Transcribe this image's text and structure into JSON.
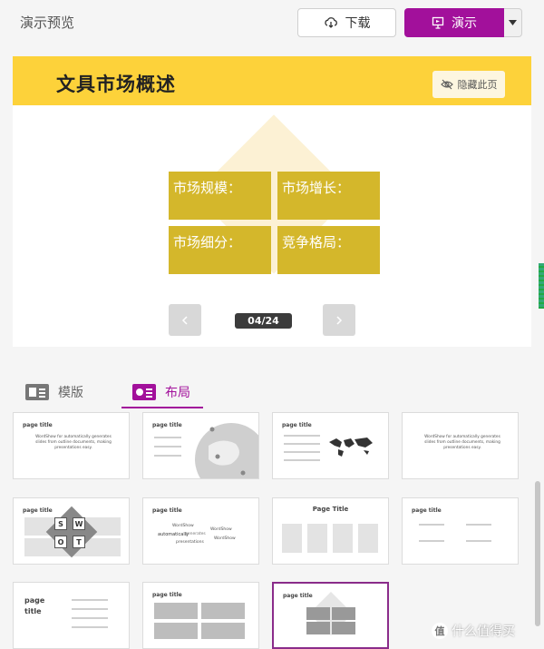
{
  "header": {
    "title": "演示预览",
    "download_label": "下载",
    "present_label": "演示"
  },
  "slide": {
    "title": "文具市场概述",
    "hide_page_label": "隐藏此页",
    "quadrants": [
      "市场规模：",
      "市场增长：",
      "市场细分：",
      "竞争格局："
    ],
    "page_indicator": "04/24"
  },
  "tabs": [
    {
      "label": "模版",
      "active": false
    },
    {
      "label": "布局",
      "active": true
    }
  ],
  "thumbnails": [
    {
      "title": "page title",
      "body": "WordShow for automatically generates slides from outline documents, making presentations easy."
    },
    {
      "title": "page title"
    },
    {
      "title": "page title"
    },
    {
      "title": "",
      "body": "WordShow for automatically generates slides from outline documents, making presentations easy."
    },
    {
      "title": "page title",
      "letters": [
        "S",
        "W",
        "O",
        "T"
      ]
    },
    {
      "title": "page title",
      "words": [
        "WordShow",
        "automatically",
        "generates",
        "WordShow",
        "presentations",
        "WordShow"
      ]
    },
    {
      "title": "Page Title"
    },
    {
      "title": "page title"
    },
    {
      "title": "page title"
    },
    {
      "title": "page title"
    },
    {
      "title": "page title",
      "selected": true
    }
  ],
  "watermark": {
    "text": "什么值得买",
    "icon_char": "值"
  },
  "colors": {
    "accent": "#a2109b",
    "slide_band": "#fdd23a",
    "quadrant": "#d4b72b"
  }
}
